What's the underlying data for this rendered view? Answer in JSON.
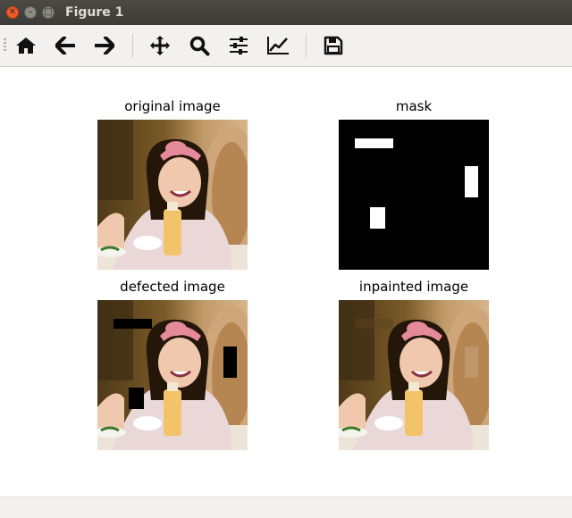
{
  "window": {
    "title": "Figure 1"
  },
  "toolbar": {
    "tools": [
      "home-icon",
      "back-arrow-icon",
      "forward-arrow-icon",
      "pan-icon",
      "zoom-icon",
      "subplots-config-icon",
      "edit-axes-icon",
      "save-icon"
    ]
  },
  "figure": {
    "subplots": [
      {
        "title": "original image"
      },
      {
        "title": "mask"
      },
      {
        "title": "defected image"
      },
      {
        "title": "inpainted image"
      }
    ]
  },
  "colors": {
    "mask_bg": "#000000",
    "mask_fg": "#ffffff"
  }
}
